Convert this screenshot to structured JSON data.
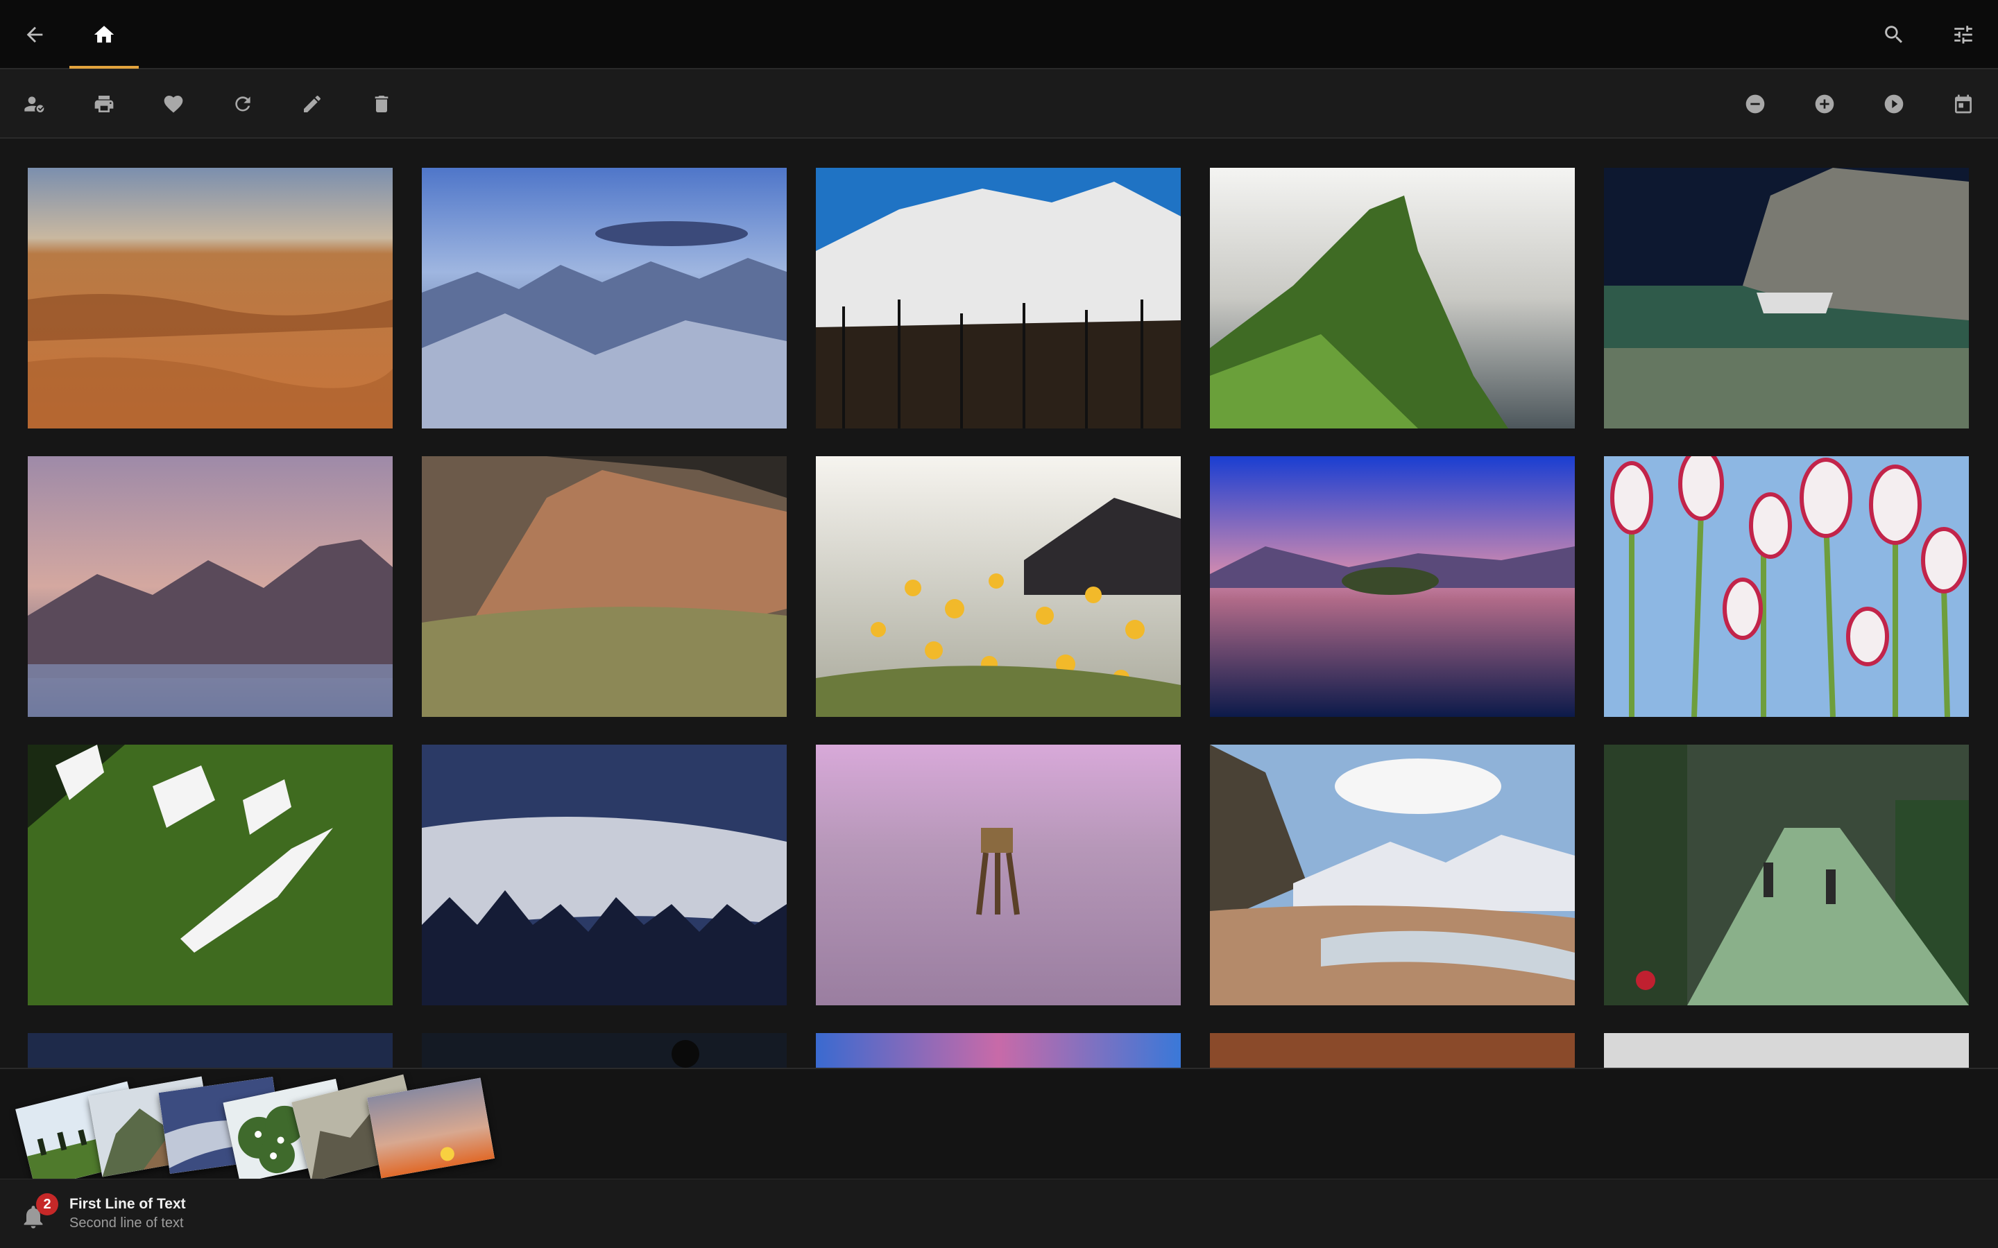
{
  "header": {
    "icons": [
      "arrow-left-icon",
      "home-icon",
      "search-icon",
      "sliders-icon"
    ]
  },
  "toolbar": {
    "left_icons": [
      "people-icon",
      "print-icon",
      "heart-icon",
      "refresh-icon",
      "pencil-icon",
      "trash-icon"
    ],
    "right_icons": [
      "zoom-out-icon",
      "zoom-in-icon",
      "play-icon",
      "calendar-icon"
    ]
  },
  "gallery": {
    "columns": 5,
    "visible_rows": 3,
    "partial_row_visible": true
  },
  "notification": {
    "badge_count": "2",
    "title": "First Line of Text",
    "subtitle": "Second line of text"
  },
  "colors": {
    "accent": "#e2a33d",
    "badge": "#c62828"
  }
}
